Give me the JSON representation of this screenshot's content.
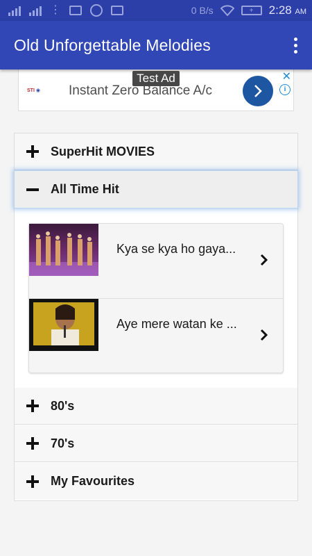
{
  "status_bar": {
    "net_speed": "0 B/s",
    "time": "2:28",
    "ampm": "AM"
  },
  "app_bar": {
    "title": "Old Unforgettable Melodies",
    "overflow_icon": "more-vert-icon"
  },
  "ad": {
    "tag": "Test Ad",
    "text": "Instant Zero Balance A/c",
    "logo_text": "STI",
    "close": "✕",
    "info": "i"
  },
  "categories": [
    {
      "label": "SuperHit MOVIES",
      "expanded": false,
      "icon": "plus-icon"
    },
    {
      "label": "All Time Hit",
      "expanded": true,
      "icon": "minus-icon"
    },
    {
      "label": "80's",
      "expanded": false,
      "icon": "plus-icon"
    },
    {
      "label": "70's",
      "expanded": false,
      "icon": "plus-icon"
    },
    {
      "label": "My Favourites",
      "expanded": false,
      "icon": "plus-icon"
    }
  ],
  "songs": [
    {
      "title": "Kya se kya ho gaya..."
    },
    {
      "title": "Aye mere watan ke ..."
    }
  ],
  "colors": {
    "status_bar": "#2c3ea8",
    "app_bar": "#3247b6",
    "ad_button": "#1d57a1",
    "active_row_glow": "#b9d4ef"
  }
}
